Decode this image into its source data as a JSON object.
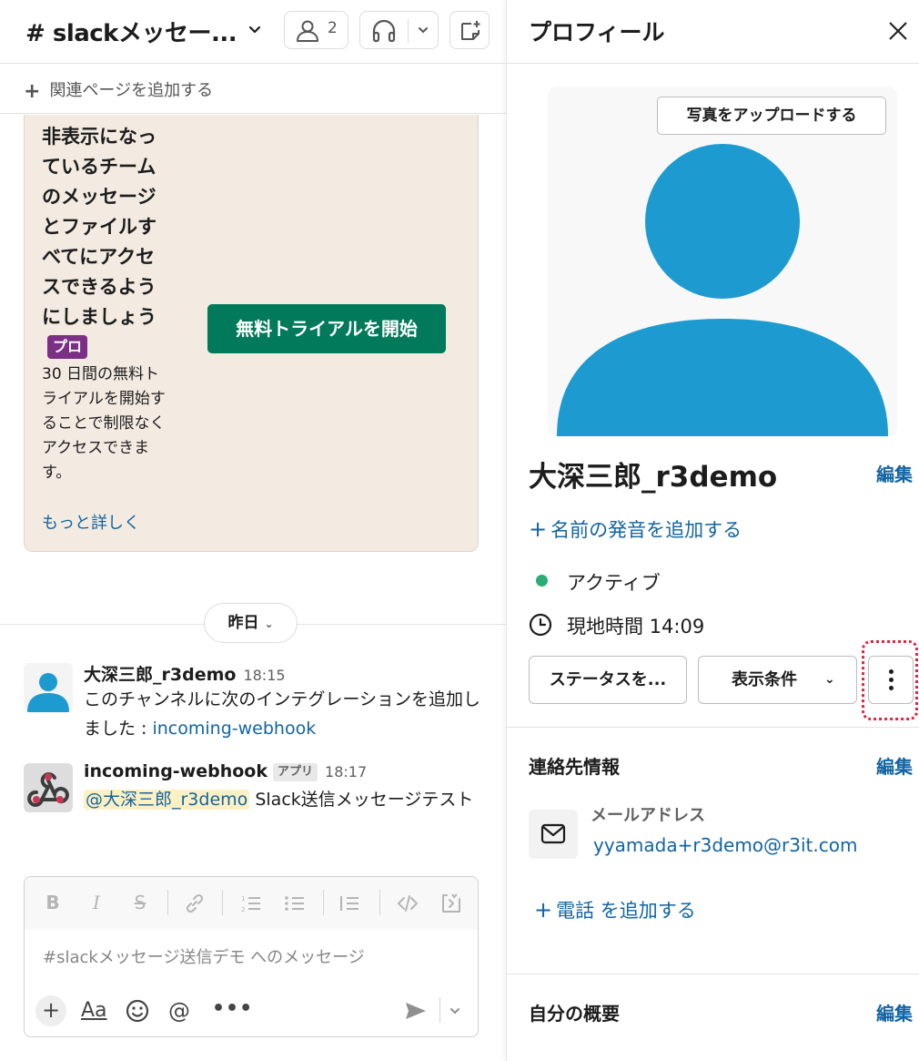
{
  "channel": {
    "title": "# slackメッセー...",
    "member_count": "2",
    "add_bookmark_label": "関連ページを追加する"
  },
  "promo": {
    "heading": "非表示になっているチームのメッセージとファイルすべてにアクセスできるようにしましょう",
    "pro_badge": "プロ",
    "body": "30 日間の無料トライアルを開始することで制限なくアクセスできます。",
    "more_link": "もっと詳しく",
    "trial_button": "無料トライアルを開始"
  },
  "divider": {
    "day_label": "昨日"
  },
  "messages": [
    {
      "author": "大深三郎_r3demo",
      "time": "18:15",
      "text_prefix": "このチャンネルに次のインテグレーションを追加しました : ",
      "link": "incoming-webhook"
    },
    {
      "author": "incoming-webhook",
      "app_badge": "アプリ",
      "time": "18:17",
      "mention": "@大深三郎_r3demo",
      "text": " Slack送信メッセージテスト"
    }
  ],
  "composer": {
    "placeholder": "#slackメッセージ送信デモ へのメッセージ",
    "format_label": "Aa"
  },
  "profile": {
    "header_title": "プロフィール",
    "upload_photo": "写真をアップロードする",
    "name": "大深三郎_r3demo",
    "edit": "編集",
    "add_pronunciation": "名前の発音を追加する",
    "status": "アクティブ",
    "local_time": "現地時間 14:09",
    "status_button": "ステータスを...",
    "view_button": "表示条件",
    "contact_title": "連絡先情報",
    "email_label": "メールアドレス",
    "email": "yyamada+r3demo@r3it.com",
    "add_phone": "電話 を追加する",
    "about_title": "自分の概要",
    "accent_color": "#1d9bd1",
    "link_color": "#1264a3",
    "active_color": "#2bac76"
  }
}
